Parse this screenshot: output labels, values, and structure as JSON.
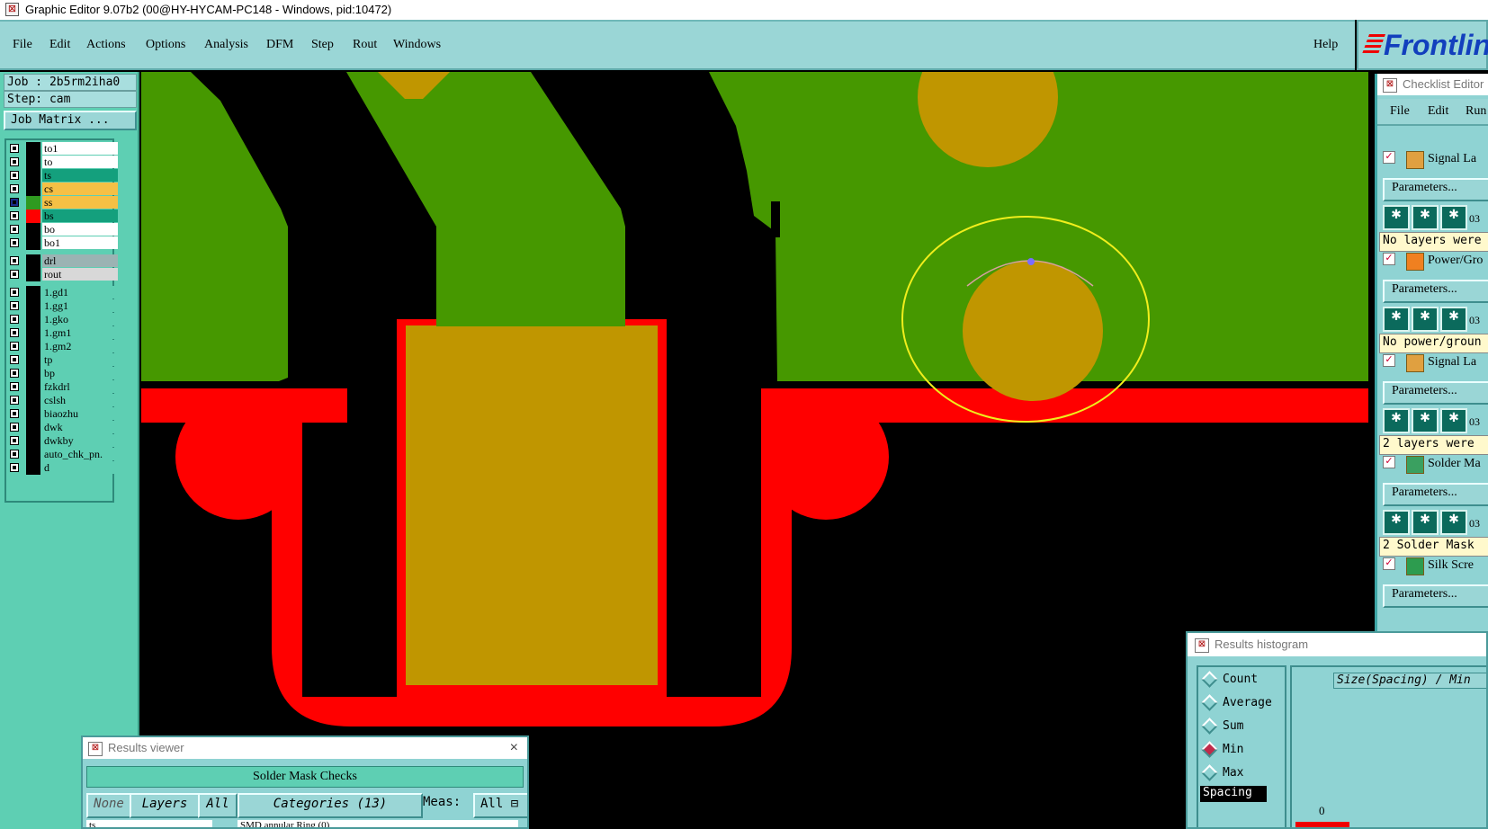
{
  "window": {
    "title": "Graphic Editor 9.07b2 (00@HY-HYCAM-PC148 - Windows, pid:10472)"
  },
  "menu": [
    "File",
    "Edit",
    "Actions",
    "Options",
    "Analysis",
    "DFM",
    "Step",
    "Rout",
    "Windows"
  ],
  "help_label": "Help",
  "logo_text": "Frontlin",
  "job": {
    "job_line": "Job : 2b5rm2iha0",
    "step_line": "Step: cam",
    "matrix_button": "Job Matrix ..."
  },
  "layers": [
    {
      "name": "to1",
      "bg": "#ffffff",
      "color": "#000000"
    },
    {
      "name": "to",
      "bg": "#ffffff",
      "color": "#000000"
    },
    {
      "name": "ts",
      "bg": "#14a07d",
      "color": "#000000"
    },
    {
      "name": "cs",
      "bg": "#f5c045",
      "color": "#000000"
    },
    {
      "name": "ss",
      "bg": "#f5c045",
      "color": "#2f9a20"
    },
    {
      "name": "bs",
      "bg": "#14a07d",
      "color": "#ff0000"
    },
    {
      "name": "bo",
      "bg": "#ffffff",
      "color": "#000000"
    },
    {
      "name": "bo1",
      "bg": "#ffffff",
      "color": "#000000"
    },
    {
      "name": "drl",
      "bg": "#9bb3b3",
      "color": "#000000"
    },
    {
      "name": "rout",
      "bg": "#d8d8d8",
      "color": "#000000"
    },
    {
      "name": "1.gd1",
      "bg": "#5ecfb3",
      "color": "#000000"
    },
    {
      "name": "1.gg1",
      "bg": "#5ecfb3",
      "color": "#000000"
    },
    {
      "name": "1.gko",
      "bg": "#5ecfb3",
      "color": "#000000"
    },
    {
      "name": "1.gm1",
      "bg": "#5ecfb3",
      "color": "#000000"
    },
    {
      "name": "1.gm2",
      "bg": "#5ecfb3",
      "color": "#000000"
    },
    {
      "name": "tp",
      "bg": "#5ecfb3",
      "color": "#000000"
    },
    {
      "name": "bp",
      "bg": "#5ecfb3",
      "color": "#000000"
    },
    {
      "name": "fzkdrl",
      "bg": "#5ecfb3",
      "color": "#000000"
    },
    {
      "name": "cslsh",
      "bg": "#5ecfb3",
      "color": "#000000"
    },
    {
      "name": "biaozhu",
      "bg": "#5ecfb3",
      "color": "#000000"
    },
    {
      "name": "dwk",
      "bg": "#5ecfb3",
      "color": "#000000"
    },
    {
      "name": "dwkby",
      "bg": "#5ecfb3",
      "color": "#000000"
    },
    {
      "name": "auto_chk_pn.",
      "bg": "#5ecfb3",
      "color": "#000000"
    },
    {
      "name": "d",
      "bg": "#5ecfb3",
      "color": "#000000"
    }
  ],
  "checklist": {
    "title": "Checklist Editor",
    "menu": [
      "File",
      "Edit",
      "Run"
    ],
    "items": [
      {
        "label": "Signal La",
        "param": "Parameters...",
        "num": "03",
        "status": "No layers were"
      },
      {
        "label": "Power/Gro",
        "param": "Parameters...",
        "num": "03",
        "status": "No power/groun"
      },
      {
        "label": "Signal La",
        "param": "Parameters...",
        "num": "03",
        "status": "2 layers were"
      },
      {
        "label": "Solder Ma",
        "param": "Parameters...",
        "num": "03",
        "status": "2 Solder Mask"
      },
      {
        "label": "Silk Scre",
        "param": "Parameters...",
        "num": "",
        "status": ""
      }
    ]
  },
  "results_viewer": {
    "title": "Results viewer",
    "banner": "Solder Mask Checks",
    "btn_none": "None",
    "btn_layers": "Layers",
    "btn_all": "All",
    "categories": "Categories (13)",
    "meas_label": "Meas:",
    "meas_value": "All",
    "layer_field": "ts",
    "category_field": "SMD annular Ring (0)"
  },
  "histogram": {
    "title": "Results histogram",
    "options": [
      "Count",
      "Average",
      "Sum",
      "Min",
      "Max"
    ],
    "selected": "Min",
    "list_item": "Spacing",
    "header": "Size(Spacing) / Min",
    "axis_zero": "0"
  },
  "colors": {
    "copper": "#469800",
    "pad": "#c09600",
    "mask": "#ff0000",
    "highlight": "#f0ee1c",
    "panel": "#5ecfb3",
    "menu": "#9ad6d6"
  }
}
